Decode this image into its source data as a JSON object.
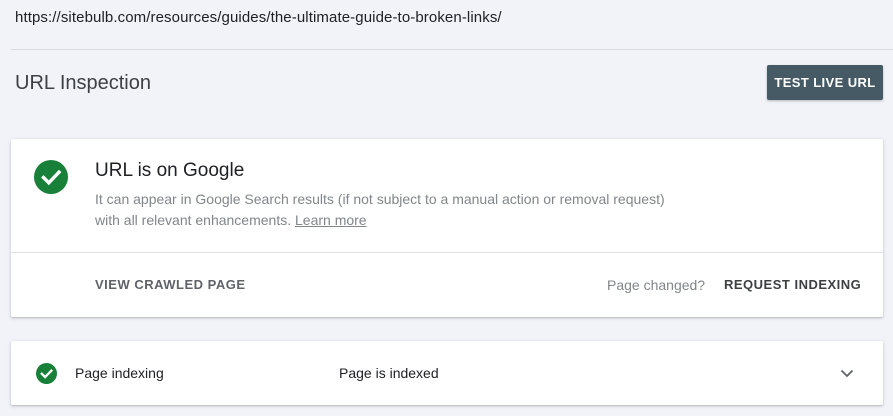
{
  "url_bar": {
    "url": "https://sitebulb.com/resources/guides/the-ultimate-guide-to-broken-links/"
  },
  "header": {
    "title": "URL Inspection",
    "test_live_label": "TEST LIVE URL"
  },
  "status_card": {
    "icon": "check-circle-icon",
    "title": "URL is on Google",
    "description": "It can appear in Google Search results (if not subject to a manual action or removal request) with all relevant enhancements.",
    "learn_more": "Learn more",
    "view_crawled_label": "VIEW CRAWLED PAGE",
    "page_changed_text": "Page changed?",
    "request_indexing_label": "REQUEST INDEXING"
  },
  "indexing_card": {
    "icon": "check-circle-icon",
    "label": "Page indexing",
    "value": "Page is indexed",
    "expand_icon": "chevron-down-icon"
  },
  "colors": {
    "background": "#f1f3f9",
    "success_green": "#188038",
    "button_dark": "#455a64"
  }
}
